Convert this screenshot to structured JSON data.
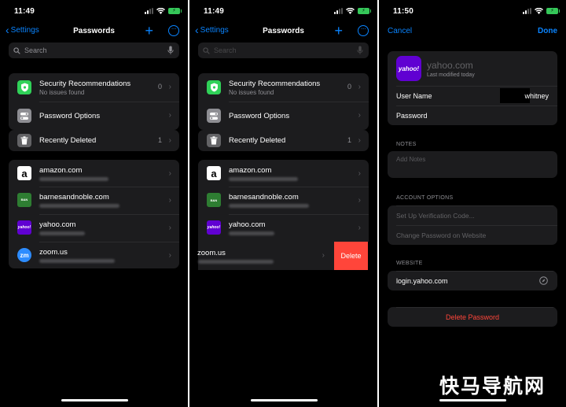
{
  "screen1": {
    "time": "11:49",
    "back_label": "Settings",
    "title": "Passwords",
    "search_placeholder": "Search",
    "security": {
      "title": "Security Recommendations",
      "subtitle": "No issues found",
      "count": "0"
    },
    "password_options": "Password Options",
    "recently_deleted": {
      "label": "Recently Deleted",
      "count": "1"
    },
    "sites": [
      {
        "name": "amazon.com",
        "icon": "amazon-logo"
      },
      {
        "name": "barnesandnoble.com",
        "icon": "barnes-noble-logo"
      },
      {
        "name": "yahoo.com",
        "icon": "yahoo-logo"
      },
      {
        "name": "zoom.us",
        "icon": "zoom-logo"
      }
    ]
  },
  "screen2": {
    "time": "11:49",
    "back_label": "Settings",
    "title": "Passwords",
    "search_placeholder": "Search",
    "security": {
      "title": "Security Recommendations",
      "subtitle": "No issues found",
      "count": "0"
    },
    "password_options": "Password Options",
    "recently_deleted": {
      "label": "Recently Deleted",
      "count": "1"
    },
    "sites": [
      {
        "name": "amazon.com"
      },
      {
        "name": "barnesandnoble.com"
      },
      {
        "name": "yahoo.com"
      }
    ],
    "swiped_site": "zoom.us",
    "delete_label": "Delete"
  },
  "screen3": {
    "time": "11:50",
    "cancel_label": "Cancel",
    "done_label": "Done",
    "site_title": "yahoo.com",
    "logo_text": "yahoo!",
    "modified": "Last modified today",
    "username_label": "User Name",
    "username_value": "whitney",
    "password_label": "Password",
    "notes_header": "NOTES",
    "notes_placeholder": "Add Notes",
    "account_options_header": "ACCOUNT OPTIONS",
    "setup_verification": "Set Up Verification Code...",
    "change_password": "Change Password on Website",
    "website_header": "WEBSITE",
    "website": "login.yahoo.com",
    "delete_password": "Delete Password"
  },
  "watermark": "快马导航网",
  "colors": {
    "accent": "#0a84ff",
    "destructive": "#ff453a",
    "cell": "#1c1c1e",
    "yahoo": "#6001d2",
    "security_green": "#30d158"
  }
}
